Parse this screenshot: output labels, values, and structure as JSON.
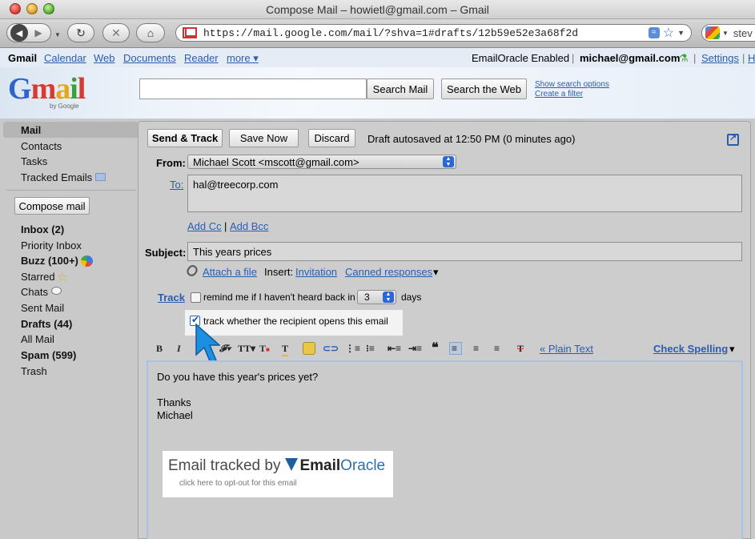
{
  "window": {
    "title": "Compose Mail – howietl@gmail.com – Gmail"
  },
  "browser": {
    "url": "https://mail.google.com/mail/?shva=1#drafts/12b59e52e3a68f2d",
    "search_text": "stev"
  },
  "gbar": {
    "items": [
      "Gmail",
      "Calendar",
      "Web",
      "Documents",
      "Reader",
      "more ▾"
    ],
    "status": "EmailOracle Enabled",
    "account": "michael@gmail.com",
    "settings": "Settings",
    "help_truncated": "H"
  },
  "header": {
    "logo_letters": [
      "G",
      "m",
      "a",
      "i",
      "l"
    ],
    "by_google": "by Google",
    "search_mail": "Search Mail",
    "search_web": "Search the Web",
    "show_search_options": "Show search options",
    "create_filter": "Create a filter"
  },
  "nav": {
    "mail": "Mail",
    "contacts": "Contacts",
    "tasks": "Tasks",
    "tracked": "Tracked Emails",
    "compose": "Compose mail",
    "inbox": "Inbox (2)",
    "priority": "Priority Inbox",
    "buzz": "Buzz (100+)",
    "starred": "Starred",
    "chats": "Chats",
    "sent": "Sent Mail",
    "drafts": "Drafts (44)",
    "all": "All Mail",
    "spam": "Spam (599)",
    "trash": "Trash"
  },
  "compose": {
    "send_track": "Send & Track",
    "save_now": "Save Now",
    "discard": "Discard",
    "autosave_status": "Draft autosaved at 12:50 PM (0 minutes ago)",
    "from_label": "From:",
    "from_value": "Michael Scott <mscott@gmail.com>",
    "to_label": "To:",
    "to_value": "hal@treecorp.com",
    "add_cc": "Add Cc",
    "sep": "|",
    "add_bcc": "Add Bcc",
    "subject_label": "Subject:",
    "subject_value": "This years prices",
    "attach": "Attach a file",
    "insert_label": "Insert:",
    "invitation": "Invitation",
    "canned": "Canned responses",
    "canned_arrow": "▾",
    "track_label": "Track",
    "remind_text": "remind me if I haven't heard back in",
    "remind_days": "3",
    "days_label": "days",
    "track_opens": "track whether the recipient opens this email",
    "plain_text": "« Plain Text",
    "check_spelling": "Check Spelling",
    "check_arrow": "▾",
    "body": [
      "Do you have this year's prices yet?",
      "Thanks",
      "Michael"
    ],
    "sig_prefix": "Email tracked by",
    "sig_brand1": "Email",
    "sig_brand2": "Oracle",
    "sig_sub": "click here to opt-out for this email"
  },
  "colors": {
    "link": "#2a5db0",
    "select_accent": "#2a67d4",
    "brand": "#2d6fb2"
  }
}
